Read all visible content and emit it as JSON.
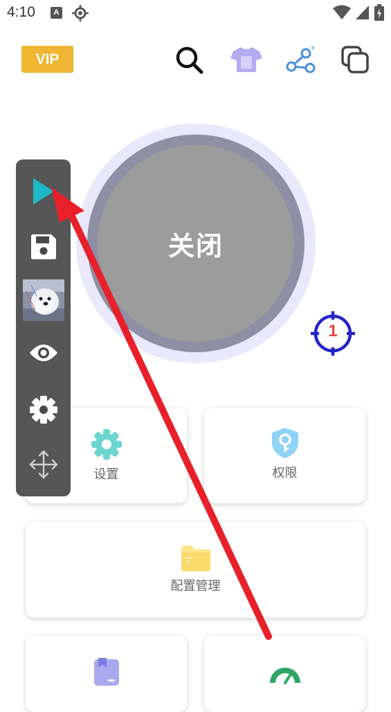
{
  "status_bar": {
    "time": "4:10",
    "notification_icon_letter": "A",
    "icons": [
      "a-notification-icon",
      "location-icon",
      "wifi-icon",
      "signal-icon",
      "battery-charging-icon"
    ]
  },
  "header": {
    "vip_label": "VIP",
    "icons": [
      "search-icon",
      "tshirt-icon",
      "share-icon",
      "copy-icon"
    ],
    "colors": {
      "vip": "#f0b533",
      "tshirt": "#b5acf2",
      "share": "#4a90d9"
    }
  },
  "main_toggle": {
    "label": "关闭",
    "colors": {
      "outer": "#e9e9fb",
      "ring": "#8e8ea4",
      "inner": "#9c9c9c"
    }
  },
  "target_badge": {
    "count": "1",
    "icon": "crosshair-icon",
    "colors": {
      "ring": "#2323c8",
      "count": "#e8453c"
    }
  },
  "cards": {
    "settings": {
      "label": "设置",
      "icon": "gear-icon",
      "color": "#6dd5d0"
    },
    "permissions": {
      "label": "权限",
      "icon": "shield-key-icon",
      "color": "#8fd3f7"
    },
    "config": {
      "label": "配置管理",
      "icon": "folder-icon",
      "color": "#fde58b"
    },
    "bookmark": {
      "icon": "bookmark-icon",
      "color": "#a9a9f0"
    },
    "speed": {
      "icon": "speedometer-icon",
      "color": "#2ea566"
    }
  },
  "floating_toolbar": {
    "items": [
      "play-icon",
      "save-icon",
      "screenshot-thumbnail",
      "eye-icon",
      "gear-icon",
      "move-icon"
    ],
    "play_color": "#1fb8c8"
  },
  "annotation": {
    "arrow_color": "#e8202a"
  }
}
